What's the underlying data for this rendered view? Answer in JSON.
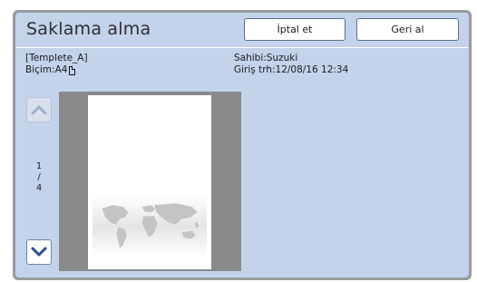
{
  "header": {
    "title": "Saklama alma",
    "cancel_label": "İptal et",
    "back_label": "Geri al"
  },
  "document": {
    "name": "[Templete_A]",
    "format": "Biçim:A4",
    "owner": "Sahibi:Suzuki",
    "entry_date": "Giriş trh:12/08/16 12:34"
  },
  "pager": {
    "current": "1",
    "separator": "/",
    "total": "4"
  },
  "icons": {
    "up": "chevron-up-icon",
    "down": "chevron-down-icon",
    "page": "portrait-page-icon"
  },
  "colors": {
    "panel": "#c3d3ec",
    "accent": "#2a4f8f"
  }
}
